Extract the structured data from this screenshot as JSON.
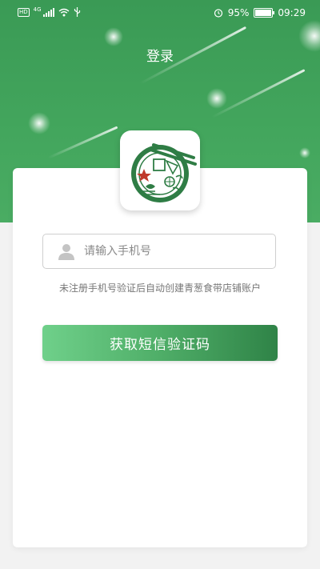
{
  "status_bar": {
    "hd": "HD",
    "network": "4G",
    "battery": "95%",
    "time": "09:29"
  },
  "header": {
    "title": "登录"
  },
  "login_form": {
    "phone_placeholder": "请输入手机号",
    "phone_value": "",
    "hint": "未注册手机号验证后自动创建青葱食带店铺账户",
    "code_button_label": "获取短信验证码"
  },
  "colors": {
    "brand_green": "#43a65d",
    "button_gradient_start": "#6fd08a",
    "button_gradient_end": "#2f8347",
    "logo_red_star": "#c0392b"
  },
  "icons": {
    "logo": "bowl-chopsticks-logo",
    "phone_field": "user-icon",
    "alarm": "alarm-icon",
    "wifi": "wifi-icon",
    "usb": "usb-icon",
    "signal": "signal-icon",
    "battery": "battery-icon"
  }
}
